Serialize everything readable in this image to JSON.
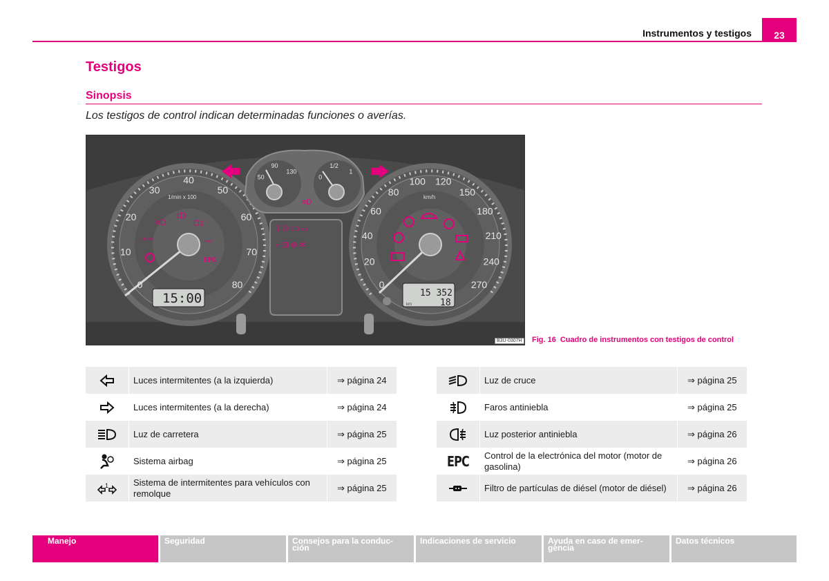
{
  "header": {
    "title": "Instrumentos y testigos",
    "page": "23"
  },
  "section": {
    "title": "Testigos",
    "subtitle": "Sinopsis",
    "intro": "Los testigos de control indican determinadas funciones o averías."
  },
  "figure": {
    "code": "B3U-0307H",
    "caption_num": "Fig. 16",
    "caption": "Cuadro de instrumentos con testigos de control",
    "tach_labels": [
      "0",
      "10",
      "20",
      "30",
      "40",
      "50",
      "60",
      "70",
      "80"
    ],
    "tach_unit": "1/min x 100",
    "speed_labels": [
      "0",
      "20",
      "40",
      "60",
      "80",
      "100",
      "120",
      "150",
      "180",
      "210",
      "240",
      "270"
    ],
    "speed_unit": "km/h",
    "temp_labels": [
      "50",
      "90",
      "130"
    ],
    "fuel_labels": [
      "0",
      "1/2",
      "1"
    ],
    "clock": "15:00",
    "odometer": "15 352",
    "trip": "18",
    "trip_unit": "km",
    "epc_label": "EPC",
    "accent": "#e4007c"
  },
  "table_left": [
    {
      "icon": "turn-left-icon",
      "text": "Luces intermitentes (a la izquierda)",
      "page": "⇒ página 24"
    },
    {
      "icon": "turn-right-icon",
      "text": "Luces intermitentes (a la derecha)",
      "page": "⇒ página 24"
    },
    {
      "icon": "high-beam-icon",
      "text": "Luz de carretera",
      "page": "⇒ página 25"
    },
    {
      "icon": "airbag-icon",
      "text": "Sistema airbag",
      "page": "⇒ página 25"
    },
    {
      "icon": "trailer-turn-icon",
      "text": "Sistema de intermitentes para vehículos con remolque",
      "page": "⇒ página 25"
    }
  ],
  "table_right": [
    {
      "icon": "low-beam-icon",
      "text": "Luz de cruce",
      "page": "⇒ página 25"
    },
    {
      "icon": "front-fog-icon",
      "text": "Faros antiniebla",
      "page": "⇒ página 25"
    },
    {
      "icon": "rear-fog-icon",
      "text": "Luz posterior antiniebla",
      "page": "⇒ página 26"
    },
    {
      "icon": "epc-icon",
      "icon_text": "EPC",
      "text": "Control de la electrónica del motor (motor de gasolina)",
      "page": "⇒ página 26"
    },
    {
      "icon": "dpf-icon",
      "text": "Filtro de partículas de diésel (motor de diésel)",
      "page": "⇒ página 26"
    }
  ],
  "footer": [
    {
      "label": "Manejo",
      "active": true
    },
    {
      "label": "Seguridad"
    },
    {
      "label": "Consejos para la conduc-\nción"
    },
    {
      "label": "Indicaciones de servicio"
    },
    {
      "label": "Ayuda en caso de emer-\ngencia"
    },
    {
      "label": "Datos técnicos"
    }
  ]
}
